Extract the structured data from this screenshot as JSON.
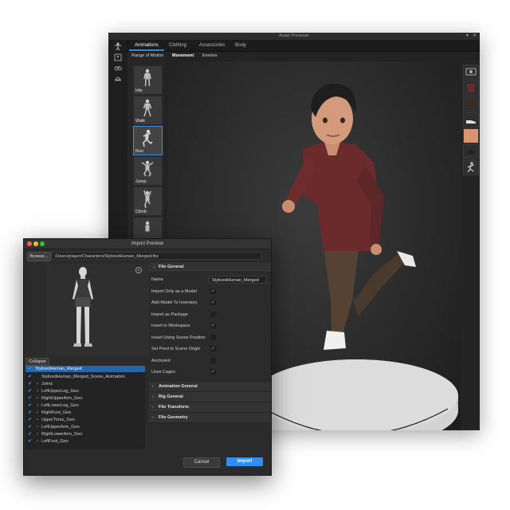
{
  "avatar_window": {
    "title": "Avatar Previewer",
    "controls": {
      "dropdown": "▾",
      "close": "✕"
    },
    "tabs": [
      {
        "label": "Animations",
        "active": true
      },
      {
        "label": "Clothing",
        "active": false
      },
      {
        "label": "Accessories",
        "active": false
      },
      {
        "label": "Body",
        "active": false
      }
    ],
    "subtabs": [
      {
        "label": "Range of Motion",
        "active": false
      },
      {
        "label": "Movement",
        "active": true
      },
      {
        "label": "Emotes",
        "active": false
      }
    ],
    "animations": [
      {
        "label": "Idle",
        "selected": false
      },
      {
        "label": "Walk",
        "selected": false
      },
      {
        "label": "Run",
        "selected": true
      },
      {
        "label": "Jump",
        "selected": false
      },
      {
        "label": "Climb",
        "selected": false
      }
    ],
    "rail_icons": [
      "figure-icon",
      "frame-icon",
      "glasses-icon",
      "hat-icon"
    ]
  },
  "import_dialog": {
    "title": "Import Preview",
    "browse_label": "Browse...",
    "path": "/Users/player/Characters/StylizedHuman_Merged.fbx",
    "collapse_label": "Collapse",
    "tree": [
      {
        "label": "StylizedHuman_Merged",
        "indent": 0,
        "arrow": false,
        "selected": true
      },
      {
        "label": "StylizedHuman_Merged_Scene_Animation",
        "indent": 1,
        "arrow": false,
        "selected": false
      },
      {
        "label": "Joints",
        "indent": 1,
        "arrow": true,
        "selected": false
      },
      {
        "label": "LeftUpperLeg_Geo",
        "indent": 1,
        "arrow": true,
        "selected": false
      },
      {
        "label": "RightUpperArm_Geo",
        "indent": 1,
        "arrow": true,
        "selected": false
      },
      {
        "label": "LeftLowerLeg_Geo",
        "indent": 1,
        "arrow": true,
        "selected": false
      },
      {
        "label": "RightFoot_Geo",
        "indent": 1,
        "arrow": true,
        "selected": false
      },
      {
        "label": "UpperTorso_Geo",
        "indent": 1,
        "arrow": true,
        "selected": false
      },
      {
        "label": "LeftUpperArm_Geo",
        "indent": 1,
        "arrow": true,
        "selected": false
      },
      {
        "label": "RightLowerArm_Geo",
        "indent": 1,
        "arrow": true,
        "selected": false
      },
      {
        "label": "LeftFoot_Geo",
        "indent": 1,
        "arrow": true,
        "selected": false
      }
    ],
    "file_general": {
      "header": "File General",
      "name_label": "Name",
      "name_value": "StylizedHuman_Merged",
      "options": [
        {
          "label": "Import Only as a Model",
          "checked": true
        },
        {
          "label": "Add Model To Inventory",
          "checked": true
        },
        {
          "label": "Import as Package",
          "checked": false
        },
        {
          "label": "Insert in Workspace",
          "checked": true
        },
        {
          "label": "Insert Using Scene Position",
          "checked": false
        },
        {
          "label": "Set Pivot to Scene Origin",
          "checked": true
        },
        {
          "label": "Anchored",
          "checked": false
        },
        {
          "label": "Uses Cages",
          "checked": true
        }
      ]
    },
    "collapsed_sections": [
      "Animation General",
      "Rig General",
      "File Transform",
      "File Geometry"
    ],
    "cancel_label": "Cancel",
    "import_label": "Import"
  },
  "colors": {
    "accent": "#2f8ef0",
    "selection": "#2565a8",
    "check": "#4aa3f0"
  }
}
